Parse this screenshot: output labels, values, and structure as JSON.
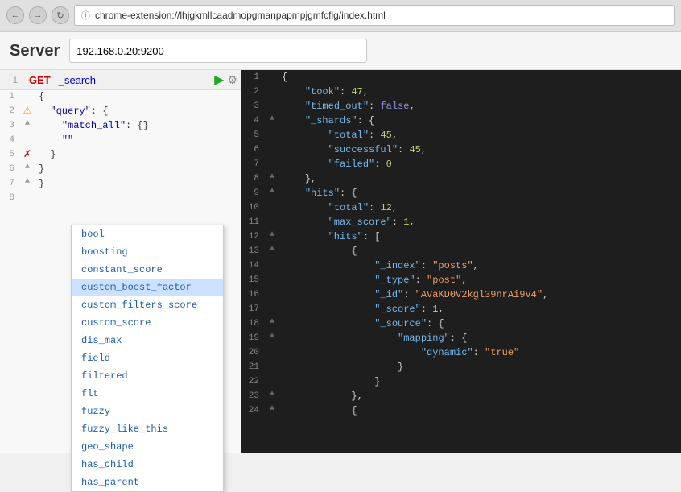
{
  "browser": {
    "url": "chrome-extension://lhjgkmllcaadmopgmanpapmpjgmfcfig/index.html",
    "back_label": "←",
    "forward_label": "→",
    "refresh_label": "↻"
  },
  "server": {
    "label": "Server",
    "address": "192.168.0.20:9200"
  },
  "editor": {
    "method": "GET",
    "path": "_search",
    "lines": [
      {
        "num": 1,
        "gutter": "",
        "content": "{",
        "gutter_type": "none"
      },
      {
        "num": 2,
        "gutter": "⚠",
        "content": "  \"query\": {",
        "gutter_type": "warn"
      },
      {
        "num": 3,
        "gutter": "▲",
        "content": "    \"match_all\": {}",
        "gutter_type": "fold"
      },
      {
        "num": 4,
        "gutter": "",
        "content": "    \"\"",
        "gutter_type": "none"
      },
      {
        "num": 5,
        "gutter": "✗",
        "content": "  }",
        "gutter_type": "error"
      },
      {
        "num": 6,
        "gutter": "▲",
        "content": "}",
        "gutter_type": "fold"
      },
      {
        "num": 7,
        "gutter": "▲",
        "content": "}",
        "gutter_type": "fold"
      },
      {
        "num": 8,
        "gutter": "",
        "content": "",
        "gutter_type": "none"
      }
    ]
  },
  "autocomplete": {
    "items": [
      "bool",
      "boosting",
      "constant_score",
      "custom_boost_factor",
      "custom_filters_score",
      "custom_score",
      "dis_max",
      "field",
      "filtered",
      "flt",
      "fuzzy",
      "fuzzy_like_this",
      "geo_shape",
      "has_child",
      "has_parent"
    ]
  },
  "results": {
    "lines": [
      {
        "num": 1,
        "gutter": "",
        "html_content": "<span class='json-brace'>{</span>"
      },
      {
        "num": 2,
        "gutter": "",
        "html_content": "    <span class='json-key'>\"took\"</span><span class='json-punct'>: </span><span class='json-number'>47</span><span class='json-punct'>,</span>"
      },
      {
        "num": 3,
        "gutter": "",
        "html_content": "    <span class='json-key'>\"timed_out\"</span><span class='json-punct'>: </span><span class='json-bool'>false</span><span class='json-punct'>,</span>"
      },
      {
        "num": 4,
        "gutter": "▲",
        "html_content": "    <span class='json-key'>\"_shards\"</span><span class='json-punct'>: {</span>"
      },
      {
        "num": 5,
        "gutter": "",
        "html_content": "        <span class='json-key'>\"total\"</span><span class='json-punct'>: </span><span class='json-number'>45</span><span class='json-punct'>,</span>"
      },
      {
        "num": 6,
        "gutter": "",
        "html_content": "        <span class='json-key'>\"successful\"</span><span class='json-punct'>: </span><span class='json-number'>45</span><span class='json-punct'>,</span>"
      },
      {
        "num": 7,
        "gutter": "",
        "html_content": "        <span class='json-key'>\"failed\"</span><span class='json-punct'>: </span><span class='json-number'>0</span>"
      },
      {
        "num": 8,
        "gutter": "▲",
        "html_content": "    <span class='json-punct'>},</span>"
      },
      {
        "num": 9,
        "gutter": "▲",
        "html_content": "    <span class='json-key'>\"hits\"</span><span class='json-punct'>: {</span>"
      },
      {
        "num": 10,
        "gutter": "",
        "html_content": "        <span class='json-key'>\"total\"</span><span class='json-punct'>: </span><span class='json-number'>12</span><span class='json-punct'>,</span>"
      },
      {
        "num": 11,
        "gutter": "",
        "html_content": "        <span class='json-key'>\"max_score\"</span><span class='json-punct'>: </span><span class='json-number'>1</span><span class='json-punct'>,</span>"
      },
      {
        "num": 12,
        "gutter": "▲",
        "html_content": "        <span class='json-key'>\"hits\"</span><span class='json-punct'>: [</span>"
      },
      {
        "num": 13,
        "gutter": "▲",
        "html_content": "            <span class='json-punct'>{</span>"
      },
      {
        "num": 14,
        "gutter": "",
        "html_content": "                <span class='json-key'>\"_index\"</span><span class='json-punct'>: </span><span class='json-string'>\"posts\"</span><span class='json-punct'>,</span>"
      },
      {
        "num": 15,
        "gutter": "",
        "html_content": "                <span class='json-key'>\"_type\"</span><span class='json-punct'>: </span><span class='json-string'>\"post\"</span><span class='json-punct'>,</span>"
      },
      {
        "num": 16,
        "gutter": "",
        "html_content": "                <span class='json-key'>\"_id\"</span><span class='json-punct'>: </span><span class='json-string'>\"AVaKD0V2kgl39nrAi9V4\"</span><span class='json-punct'>,</span>"
      },
      {
        "num": 17,
        "gutter": "",
        "html_content": "                <span class='json-key'>\"_score\"</span><span class='json-punct'>: </span><span class='json-number'>1</span><span class='json-punct'>,</span>"
      },
      {
        "num": 18,
        "gutter": "▲",
        "html_content": "                <span class='json-key'>\"_source\"</span><span class='json-punct'>: {</span>"
      },
      {
        "num": 19,
        "gutter": "▲",
        "html_content": "                    <span class='json-key'>\"mapping\"</span><span class='json-punct'>: {</span>"
      },
      {
        "num": 20,
        "gutter": "",
        "html_content": "                        <span class='json-key'>\"dynamic\"</span><span class='json-punct'>: </span><span class='json-string'>\"true\"</span>"
      },
      {
        "num": 21,
        "gutter": "",
        "html_content": "                    <span class='json-punct'>}</span>"
      },
      {
        "num": 22,
        "gutter": "",
        "html_content": "                <span class='json-punct'>}</span>"
      },
      {
        "num": 23,
        "gutter": "▲",
        "html_content": "            <span class='json-punct'>},</span>"
      },
      {
        "num": 24,
        "gutter": "▲",
        "html_content": "            <span class='json-punct'>{</span>"
      }
    ]
  }
}
